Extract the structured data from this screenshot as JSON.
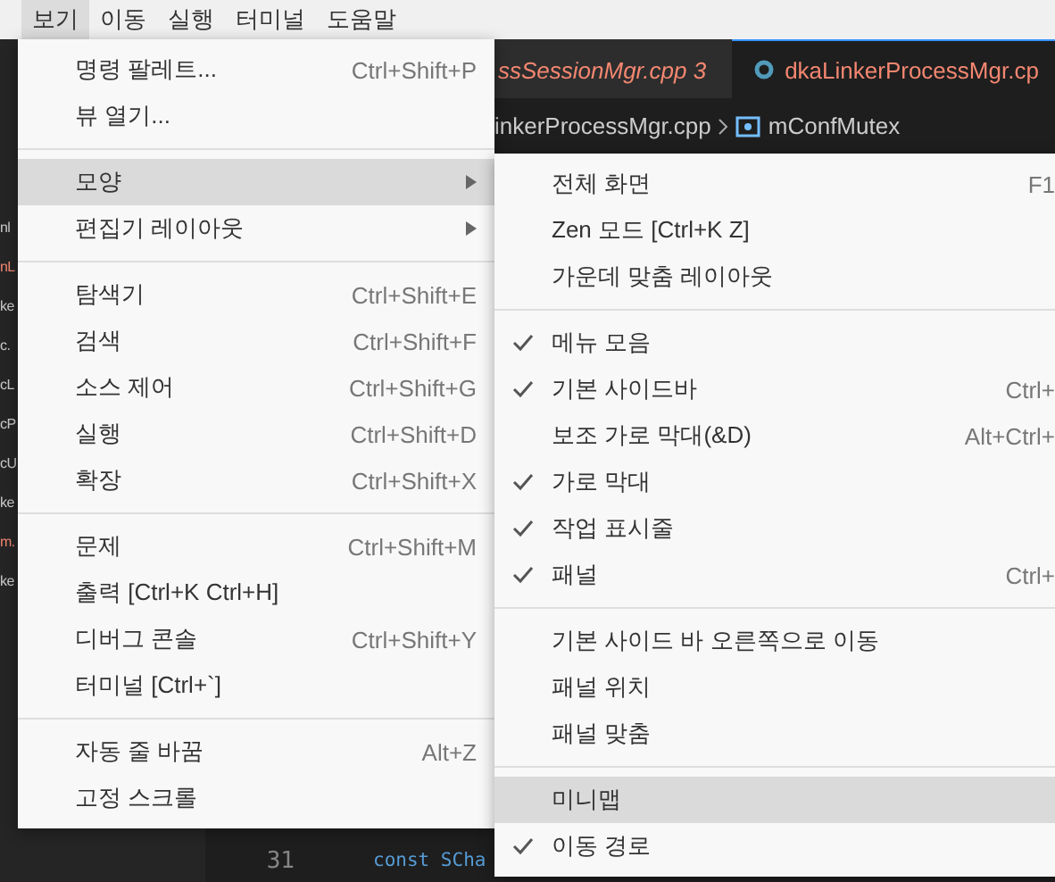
{
  "menubar": [
    {
      "label": "보기",
      "selected": true
    },
    {
      "label": "이동",
      "selected": false
    },
    {
      "label": "실행",
      "selected": false
    },
    {
      "label": "터미널",
      "selected": false
    },
    {
      "label": "도움말",
      "selected": false
    }
  ],
  "sidebar": {
    "items": [
      {
        "text": "nl",
        "modified": false
      },
      {
        "text": "nL",
        "modified": true
      },
      {
        "text": "ke",
        "modified": false
      },
      {
        "text": "c.",
        "modified": false
      },
      {
        "text": "cL",
        "modified": false
      },
      {
        "text": "cP",
        "modified": false
      },
      {
        "text": "cU",
        "modified": false
      },
      {
        "text": "ke",
        "modified": false
      },
      {
        "text": "m.",
        "modified": true
      },
      {
        "text": "ke",
        "modified": false
      }
    ]
  },
  "tabs": [
    {
      "label": "ssSessionMgr.cpp 3",
      "selected": false
    },
    {
      "label": "dkaLinkerProcessMgr.cp",
      "selected": true
    }
  ],
  "breadcrumb": [
    "inkerProcessMgr.cpp",
    "mConfMutex"
  ],
  "code": [
    {
      "line": "31",
      "text": "const SCha"
    }
  ],
  "view_menu": {
    "groups": [
      [
        {
          "label": "명령 팔레트...",
          "shortcut": "Ctrl+Shift+P",
          "selected": false,
          "submenu": false
        },
        {
          "label": "뷰 열기...",
          "selected": false,
          "submenu": false
        }
      ],
      [
        {
          "label": "모양",
          "selected": true,
          "submenu": true
        },
        {
          "label": "편집기 레이아웃",
          "selected": false,
          "submenu": true
        }
      ],
      [
        {
          "label": "탐색기",
          "shortcut": "Ctrl+Shift+E",
          "selected": false,
          "submenu": false
        },
        {
          "label": "검색",
          "shortcut": "Ctrl+Shift+F",
          "selected": false,
          "submenu": false
        },
        {
          "label": "소스 제어",
          "shortcut": "Ctrl+Shift+G",
          "selected": false,
          "submenu": false
        },
        {
          "label": "실행",
          "shortcut": "Ctrl+Shift+D",
          "selected": false,
          "submenu": false
        },
        {
          "label": "확장",
          "shortcut": "Ctrl+Shift+X",
          "selected": false,
          "submenu": false
        }
      ],
      [
        {
          "label": "문제",
          "shortcut": "Ctrl+Shift+M",
          "selected": false,
          "submenu": false
        },
        {
          "label": "출력 [Ctrl+K Ctrl+H]",
          "selected": false,
          "submenu": false
        },
        {
          "label": "디버그 콘솔",
          "shortcut": "Ctrl+Shift+Y",
          "selected": false,
          "submenu": false
        },
        {
          "label": "터미널 [Ctrl+`]",
          "selected": false,
          "submenu": false
        }
      ],
      [
        {
          "label": "자동 줄 바꿈",
          "shortcut": "Alt+Z",
          "selected": false,
          "submenu": false
        },
        {
          "label": "고정 스크롤",
          "selected": false,
          "submenu": false
        }
      ]
    ]
  },
  "appearance_menu": {
    "groups": [
      [
        {
          "label": "전체 화면",
          "shortcut": "F1",
          "checked": false,
          "selected": false
        },
        {
          "label": "Zen 모드 [Ctrl+K Z]",
          "checked": false,
          "selected": false
        },
        {
          "label": "가운데 맞춤 레이아웃",
          "checked": false,
          "selected": false
        }
      ],
      [
        {
          "label": "메뉴 모음",
          "checked": true,
          "selected": false
        },
        {
          "label": "기본 사이드바",
          "shortcut": "Ctrl+",
          "checked": true,
          "selected": false
        },
        {
          "label": "보조 가로 막대(&D)",
          "shortcut": "Alt+Ctrl+",
          "checked": false,
          "selected": false
        },
        {
          "label": "가로 막대",
          "checked": true,
          "selected": false
        },
        {
          "label": "작업 표시줄",
          "checked": true,
          "selected": false
        },
        {
          "label": "패널",
          "shortcut": "Ctrl+",
          "checked": true,
          "selected": false
        }
      ],
      [
        {
          "label": "기본 사이드 바 오른쪽으로 이동",
          "checked": false,
          "selected": false
        },
        {
          "label": "패널 위치",
          "checked": false,
          "selected": false
        },
        {
          "label": "패널 맞춤",
          "checked": false,
          "selected": false
        }
      ],
      [
        {
          "label": "미니맵",
          "checked": false,
          "selected": true
        },
        {
          "label": "이동 경로",
          "checked": true,
          "selected": false
        }
      ]
    ]
  }
}
